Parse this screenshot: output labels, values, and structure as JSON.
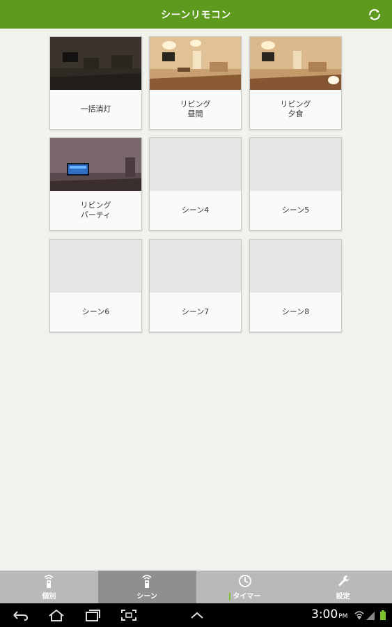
{
  "app_bar": {
    "title": "シーンリモコン",
    "refresh_icon": "refresh-icon"
  },
  "scenes": [
    {
      "line1": "一括消灯",
      "line2": "",
      "thumb": "room-dark"
    },
    {
      "line1": "リビング",
      "line2": "昼間",
      "thumb": "room-bright"
    },
    {
      "line1": "リビング",
      "line2": "夕食",
      "thumb": "room-bright"
    },
    {
      "line1": "リビング",
      "line2": "パーティ",
      "thumb": "room-party"
    },
    {
      "line1": "シーン4",
      "line2": "",
      "thumb": "empty"
    },
    {
      "line1": "シーン5",
      "line2": "",
      "thumb": "empty"
    },
    {
      "line1": "シーン6",
      "line2": "",
      "thumb": "empty"
    },
    {
      "line1": "シーン7",
      "line2": "",
      "thumb": "empty"
    },
    {
      "line1": "シーン8",
      "line2": "",
      "thumb": "empty"
    }
  ],
  "tabs": [
    {
      "label": "個別",
      "icon": "remote-icon",
      "active": false
    },
    {
      "label": "シーン",
      "icon": "remote-icon",
      "active": true
    },
    {
      "label": "タイマー",
      "icon": "clock-icon",
      "active": false
    },
    {
      "label": "設定",
      "icon": "wrench-icon",
      "active": false
    }
  ],
  "system_bar": {
    "time": "3:00",
    "ampm": "PM"
  },
  "colors": {
    "accent": "#5d9a1e",
    "tab_bg": "#b9b9b9",
    "tab_active": "#8f8f8f",
    "background": "#f2f2ed"
  }
}
